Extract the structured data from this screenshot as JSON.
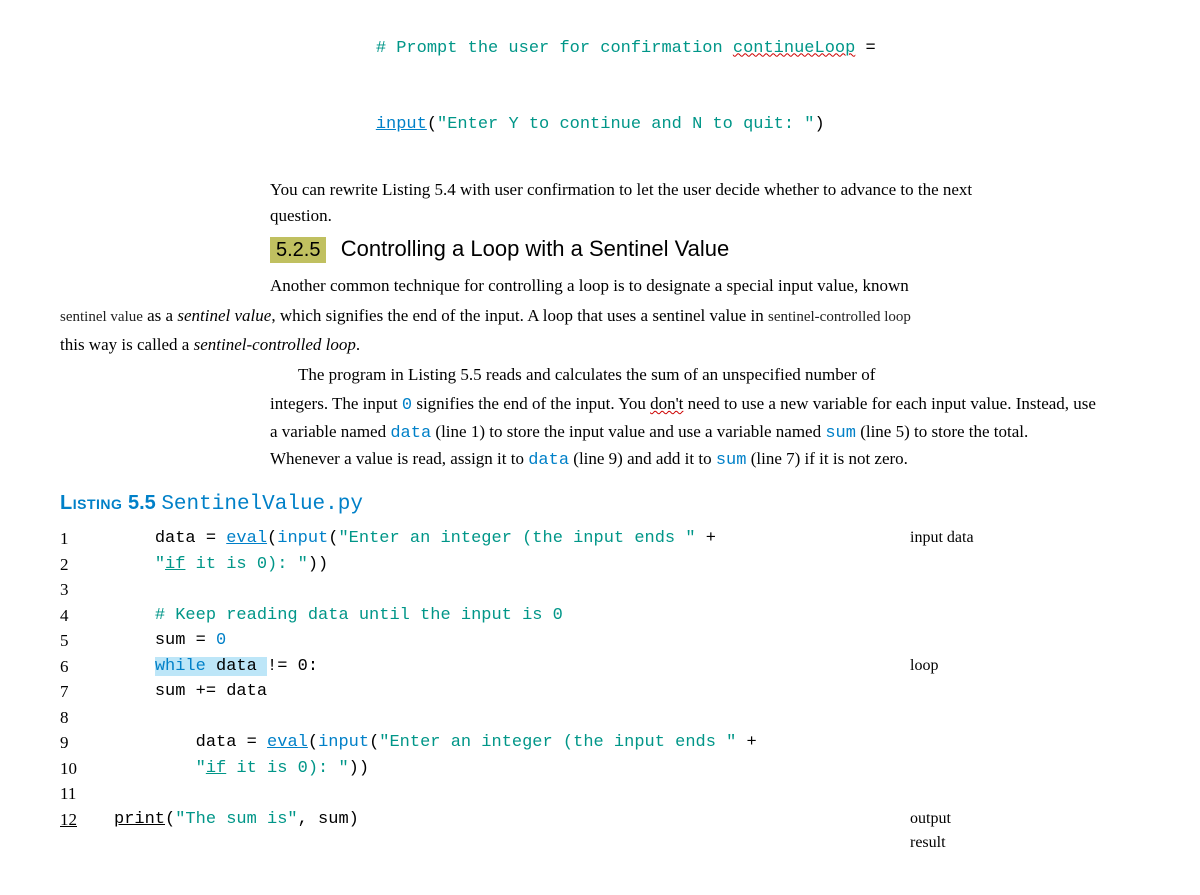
{
  "topcode": {
    "line1_comment": "# Prompt the user for confirmation ",
    "line1_continue": "continueLoop",
    "line1_eq": " =",
    "line2_input": "input",
    "line2_paren": "(",
    "line2_str": "\"Enter Y to continue and N to quit: \"",
    "line2_close": ")"
  },
  "after_top": "You can rewrite Listing 5.4 with user confirmation to let the user decide whether to advance to the next question.",
  "section": {
    "num": "5.2.5",
    "title": "Controlling a Loop with a Sentinel Value"
  },
  "para1": {
    "lead": "Another common technique for controlling a loop is to designate a special input value, known ",
    "margin1": "sentinel value",
    "mid1": " as a ",
    "ital1": "sentinel value",
    "mid2": ", which signifies the end of the input. A loop that uses a sentinel value in ",
    "margin2": "sentinel-controlled loop",
    "mid3": " this way is called a ",
    "ital2": "sentinel-controlled loop",
    "end": "."
  },
  "para2a": "The program in Listing 5.5 reads and calculates the sum of an unspecified number of ",
  "para2b": "integers. The input ",
  "para2_zero": "0",
  "para2c": " signifies the end of the input. You ",
  "para2_dont": "don't",
  "para2d": " need to use a new variable for each input value. Instead, use a variable named ",
  "para2_data": "data",
  "para2e": " (line 1) to store the input value and use a variable named ",
  "para2_sum": "sum",
  "para2f": " (line 5) to store the total. Whenever a value is read, assign it to ",
  "para2_data2": "data",
  "para2g": " (line 9) and add it to ",
  "para2_sum2": "sum",
  "para2h": " (line 7) if it is not zero.",
  "listing": {
    "label": "Listing",
    "num": "5.5",
    "fname": "SentinelValue.py"
  },
  "code": {
    "ln1": "1",
    "c1a": "data = ",
    "c1b": "eval",
    "c1c": "(",
    "c1d": "input",
    "c1e": "(",
    "c1f": "\"Enter an integer (the input ends \"",
    "c1g": " +",
    "ln2": "2",
    "c2a": "\"",
    "c2b": "if",
    "c2c": " it is 0): \"",
    "c2d": "))",
    "ln3": "3",
    "ln4": "4",
    "c4": "# Keep reading data until the input is 0",
    "ln5": "5",
    "c5a": "sum = ",
    "c5b": "0",
    "ln6": "6",
    "c6a": "while ",
    "c6b": "data ",
    "c6c": "!= 0:",
    "ln7": "7",
    "c7": "sum += data",
    "ln8": "8",
    "ln9": "9",
    "c9a": "data = ",
    "c9b": "eval",
    "c9c": "(",
    "c9d": "input",
    "c9e": "(",
    "c9f": "\"Enter an integer (the input ends \"",
    "c9g": " +",
    "ln10": "10",
    "c10a": "\"",
    "c10b": "if",
    "c10c": " it is 0): \"",
    "c10d": "))",
    "ln11": "11",
    "ln12": "12",
    "c12a": "print",
    "c12b": "(",
    "c12c": "\"The sum is\"",
    "c12d": ", sum)",
    "anno1": "input data",
    "anno6": "loop",
    "anno12a": "output",
    "anno12b": "result"
  }
}
